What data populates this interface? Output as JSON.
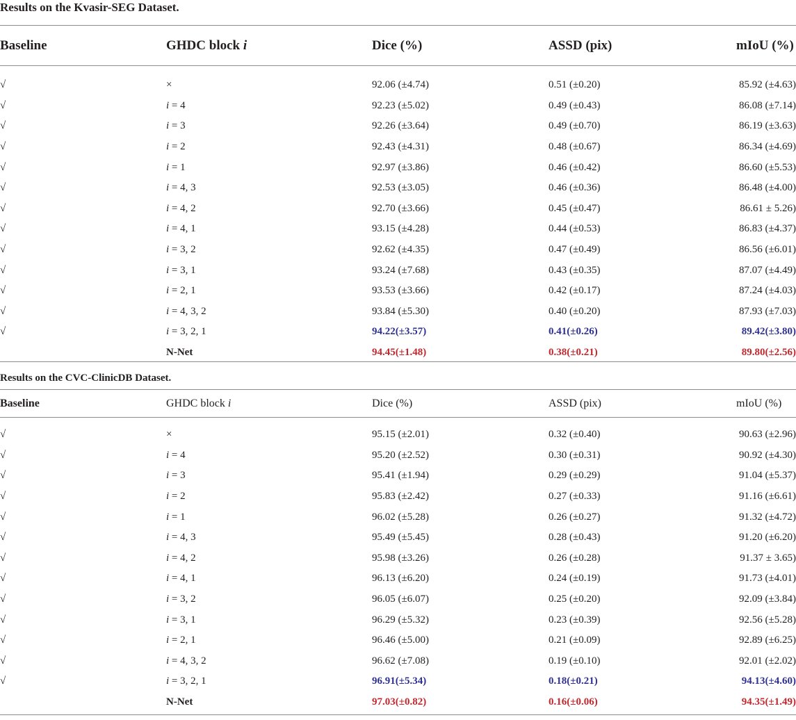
{
  "table1": {
    "title": "Results on the Kvasir-SEG Dataset.",
    "headers": {
      "baseline": "Baseline",
      "ghdc_prefix": "GHDC block ",
      "ghdc_var": "i",
      "dice": "Dice (%)",
      "assd": "ASSD (pix)",
      "miou": "mIoU (%)"
    },
    "rows": [
      {
        "baseline": "√",
        "block": "×",
        "dice": "92.06 (±4.74)",
        "assd": "0.51 (±0.20)",
        "miou": "85.92 (±4.63)"
      },
      {
        "baseline": "√",
        "block": "i = 4",
        "dice": "92.23 (±5.02)",
        "assd": "0.49 (±0.43)",
        "miou": "86.08 (±7.14)"
      },
      {
        "baseline": "√",
        "block": "i = 3",
        "dice": "92.26 (±3.64)",
        "assd": "0.49 (±0.70)",
        "miou": "86.19 (±3.63)"
      },
      {
        "baseline": "√",
        "block": "i = 2",
        "dice": "92.43 (±4.31)",
        "assd": "0.48 (±0.67)",
        "miou": "86.34 (±4.69)"
      },
      {
        "baseline": "√",
        "block": "i = 1",
        "dice": "92.97 (±3.86)",
        "assd": "0.46 (±0.42)",
        "miou": "86.60 (±5.53)"
      },
      {
        "baseline": "√",
        "block": "i = 4, 3",
        "dice": "92.53 (±3.05)",
        "assd": "0.46 (±0.36)",
        "miou": "86.48 (±4.00)"
      },
      {
        "baseline": "√",
        "block": "i = 4, 2",
        "dice": "92.70 (±3.66)",
        "assd": "0.45 (±0.47)",
        "miou": "86.61 ± 5.26)"
      },
      {
        "baseline": "√",
        "block": "i = 4, 1",
        "dice": "93.15 (±4.28)",
        "assd": "0.44 (±0.53)",
        "miou": "86.83 (±4.37)"
      },
      {
        "baseline": "√",
        "block": "i = 3, 2",
        "dice": "92.62 (±4.35)",
        "assd": "0.47 (±0.49)",
        "miou": "86.56 (±6.01)"
      },
      {
        "baseline": "√",
        "block": "i = 3, 1",
        "dice": "93.24 (±7.68)",
        "assd": "0.43 (±0.35)",
        "miou": "87.07 (±4.49)"
      },
      {
        "baseline": "√",
        "block": "i = 2, 1",
        "dice": "93.53 (±3.66)",
        "assd": "0.42 (±0.17)",
        "miou": "87.24 (±4.03)"
      },
      {
        "baseline": "√",
        "block": "i = 4, 3, 2",
        "dice": "93.84 (±5.30)",
        "assd": "0.40 (±0.20)",
        "miou": "87.93 (±7.03)"
      },
      {
        "baseline": "√",
        "block": "i = 3, 2, 1",
        "dice": "94.22(±3.57)",
        "assd": "0.41(±0.26)",
        "miou": "89.42(±3.80)"
      },
      {
        "baseline": "",
        "block": "N-Net",
        "dice": "94.45(±1.48)",
        "assd": "0.38(±0.21)",
        "miou": "89.80(±2.56)"
      }
    ]
  },
  "table2": {
    "title": "Results on the CVC-ClinicDB Dataset.",
    "headers": {
      "baseline": "Baseline",
      "ghdc_prefix": "GHDC block ",
      "ghdc_var": "i",
      "dice": "Dice (%)",
      "assd": "ASSD (pix)",
      "miou": "mIoU (%)"
    },
    "rows": [
      {
        "baseline": "√",
        "block": "×",
        "dice": "95.15 (±2.01)",
        "assd": "0.32 (±0.40)",
        "miou": "90.63 (±2.96)"
      },
      {
        "baseline": "√",
        "block": "i = 4",
        "dice": "95.20 (±2.52)",
        "assd": "0.30 (±0.31)",
        "miou": "90.92 (±4.30)"
      },
      {
        "baseline": "√",
        "block": "i = 3",
        "dice": "95.41 (±1.94)",
        "assd": "0.29 (±0.29)",
        "miou": "91.04 (±5.37)"
      },
      {
        "baseline": "√",
        "block": "i = 2",
        "dice": "95.83 (±2.42)",
        "assd": "0.27 (±0.33)",
        "miou": "91.16 (±6.61)"
      },
      {
        "baseline": "√",
        "block": "i = 1",
        "dice": "96.02 (±5.28)",
        "assd": "0.26 (±0.27)",
        "miou": "91.32 (±4.72)"
      },
      {
        "baseline": "√",
        "block": "i = 4, 3",
        "dice": "95.49 (±5.45)",
        "assd": "0.28 (±0.43)",
        "miou": "91.20 (±6.20)"
      },
      {
        "baseline": "√",
        "block": "i = 4, 2",
        "dice": "95.98 (±3.26)",
        "assd": "0.26 (±0.28)",
        "miou": "91.37 ± 3.65)"
      },
      {
        "baseline": "√",
        "block": "i = 4, 1",
        "dice": "96.13 (±6.20)",
        "assd": "0.24 (±0.19)",
        "miou": "91.73 (±4.01)"
      },
      {
        "baseline": "√",
        "block": "i = 3, 2",
        "dice": "96.05 (±6.07)",
        "assd": "0.25 (±0.20)",
        "miou": "92.09 (±3.84)"
      },
      {
        "baseline": "√",
        "block": "i = 3, 1",
        "dice": "96.29 (±5.32)",
        "assd": "0.23 (±0.39)",
        "miou": "92.56 (±5.28)"
      },
      {
        "baseline": "√",
        "block": "i = 2, 1",
        "dice": "96.46 (±5.00)",
        "assd": "0.21 (±0.09)",
        "miou": "92.89 (±6.25)"
      },
      {
        "baseline": "√",
        "block": "i = 4, 3, 2",
        "dice": "96.62 (±7.08)",
        "assd": "0.19 (±0.10)",
        "miou": "92.01 (±2.02)"
      },
      {
        "baseline": "√",
        "block": "i = 3, 2, 1",
        "dice": "96.91(±5.34)",
        "assd": "0.18(±0.21)",
        "miou": "94.13(±4.60)"
      },
      {
        "baseline": "",
        "block": "N-Net",
        "dice": "97.03(±0.82)",
        "assd": "0.16(±0.06)",
        "miou": "94.35(±1.49)"
      }
    ]
  },
  "colors": {
    "text": "#231f20",
    "second_best": "#2e3192",
    "best": "#c1272d",
    "rule": "#8a8a8a"
  }
}
